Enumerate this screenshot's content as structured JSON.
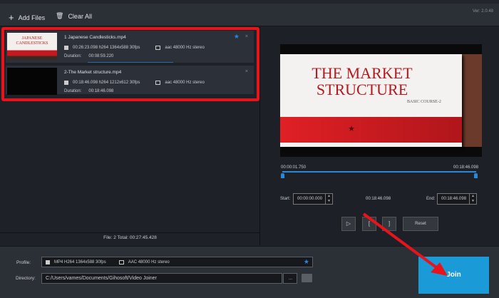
{
  "toolbar": {
    "add_files": "Add Files",
    "clear_all": "Clear All",
    "version": "Ver: 2.0.48"
  },
  "files": [
    {
      "name": "1 Japanese Candlesticks.mp4",
      "video": "00:26:23.098 h264 1364x588 30fps",
      "audio": "aac 48000 Hz stereo",
      "duration_label": "Duration:",
      "duration": "00:08:59.220",
      "thumb_text": "JAPANESE CANDLESTICKS",
      "starred": true
    },
    {
      "name": "2-The Market structure.mp4",
      "video": "00:18:46.098 h264 1212x612 30fps",
      "audio": "aac 48000 Hz stereo",
      "duration_label": "Duration:",
      "duration": "00:18:46.098",
      "starred": false
    }
  ],
  "file_stat": "File: 2  Total: 00:27:45.428",
  "preview": {
    "title1": "THE MARKET",
    "title2": "STRUCTURE",
    "subtitle": "BASIC COURSE-2"
  },
  "timeline": {
    "left_time": "00:00:01.750",
    "right_time": "00:18:46.098",
    "position_fraction": 0.0016
  },
  "trim": {
    "start_label": "Start:",
    "start": "00:00:00.000",
    "middle": "00:18:46.098",
    "end_label": "End:",
    "end": "00:18:46.098"
  },
  "controls": {
    "play": "▷",
    "mark_in": "[",
    "mark_out": "]",
    "reset": "Reset"
  },
  "bottom": {
    "profile_label": "Profile:",
    "profile_video": "MP4 H264 1364x588 30fps",
    "profile_audio": "AAC 48000 Hz stereo",
    "directory_label": "Directory:",
    "directory": "C:/Users/vames/Documents/Gihosoft/Video Joiner",
    "browse": "...",
    "join": "Join"
  },
  "colors": {
    "accent": "#1b9ad8",
    "highlight": "#e8141b"
  }
}
